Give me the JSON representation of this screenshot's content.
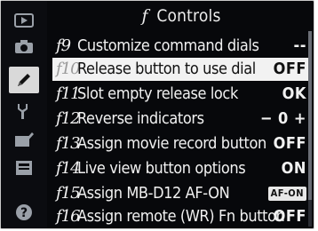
{
  "title": {
    "prefix": "f",
    "text": "Controls"
  },
  "menu_items": [
    {
      "code": "f9",
      "label": "Customize command dials",
      "value": "--",
      "selected": false
    },
    {
      "code": "f10",
      "label": "Release button to use dial",
      "value": "OFF",
      "selected": true
    },
    {
      "code": "f11",
      "label": "Slot empty release lock",
      "value": "OK",
      "selected": false
    },
    {
      "code": "f12",
      "label": "Reverse indicators",
      "value": "− 0 +",
      "selected": false
    },
    {
      "code": "f13",
      "label": "Assign movie record button",
      "value": "OFF",
      "selected": false
    },
    {
      "code": "f14",
      "label": "Live view button options",
      "value": "ON",
      "selected": false
    },
    {
      "code": "f15",
      "label": "Assign MB-D12 AF-ON",
      "value": "AF-ON",
      "selected": false
    },
    {
      "code": "f16",
      "label": "Assign remote (WR) Fn button",
      "value": "OFF",
      "selected": false
    }
  ],
  "sidebar_icons": [
    "playback-icon",
    "camera-icon",
    "pencil-icon",
    "wrench-icon",
    "retouch-icon",
    "my-menu-icon",
    "help-icon"
  ],
  "help_symbol": "?",
  "colors": {
    "background": "#07080b",
    "selected_row": "#f2f2f2",
    "text": "#f1f1f1"
  }
}
